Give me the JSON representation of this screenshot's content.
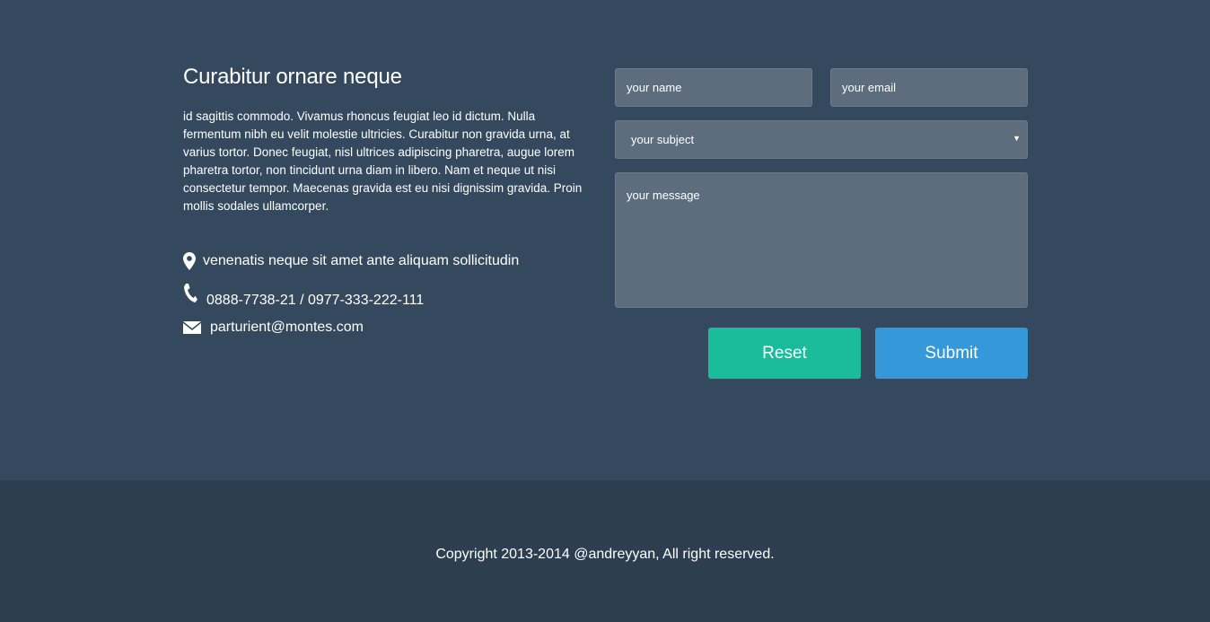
{
  "contact": {
    "heading": "Curabitur ornare neque",
    "description": "id sagittis commodo. Vivamus rhoncus feugiat leo id dictum. Nulla fermentum nibh eu velit molestie ultricies. Curabitur non gravida urna, at varius tortor. Donec feugiat, nisl ultrices adipiscing pharetra, augue lorem pharetra tortor, non tincidunt urna diam in libero. Nam et neque ut nisi consectetur tempor. Maecenas gravida est eu nisi dignissim gravida. Proin mollis sodales ullamcorper.",
    "address": "venenatis neque sit amet ante aliquam sollicitudin",
    "phone": "0888-7738-21 / 0977-333-222-111",
    "email": "parturient@montes.com",
    "icons": {
      "address": "map-marker-icon",
      "phone": "phone-icon",
      "email": "envelope-icon"
    }
  },
  "form": {
    "name_placeholder": "your name",
    "email_placeholder": "your email",
    "subject_selected": "your subject",
    "message_placeholder": "your message",
    "reset_label": "Reset",
    "submit_label": "Submit"
  },
  "footer": {
    "copyright": "Copyright 2013-2014 @andreyyan, All right reserved."
  },
  "colors": {
    "section_bg": "#34495e",
    "footer_bg": "#2c3e50",
    "field_bg": "#5d6d7e",
    "reset": "#1abc9c",
    "submit": "#3498db"
  }
}
